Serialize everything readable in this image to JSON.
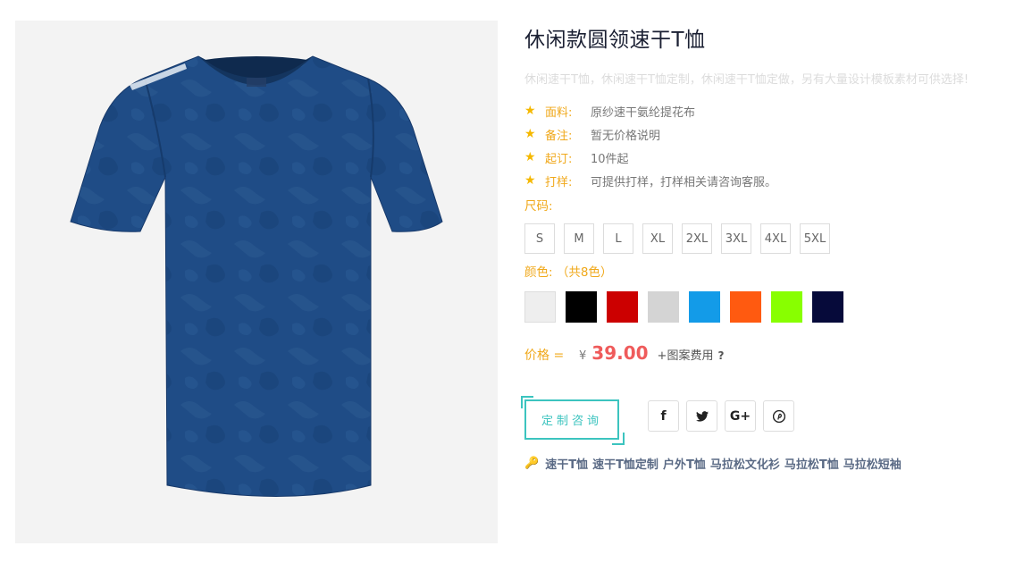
{
  "product": {
    "title": "休闲款圆领速干T恤",
    "description": "休闲速干T恤，休闲速干T恤定制，休闲速干T恤定做，另有大量设计模板素材可供选择!",
    "image_alt": "navy-short-sleeve-tshirt"
  },
  "specs": [
    {
      "icon": "star-icon",
      "key": "面料:",
      "value": "原纱速干氨纶提花布"
    },
    {
      "icon": "star-icon",
      "key": "备注:",
      "value": "暂无价格说明"
    },
    {
      "icon": "star-icon",
      "key": "起订:",
      "value": "10件起"
    },
    {
      "icon": "star-icon",
      "key": "打样:",
      "value": "可提供打样，打样相关请咨询客服。"
    }
  ],
  "sizes": {
    "label": "尺码:",
    "options": [
      "S",
      "M",
      "L",
      "XL",
      "2XL",
      "3XL",
      "4XL",
      "5XL"
    ]
  },
  "colors": {
    "label": "颜色: （共8色）",
    "swatches": [
      "#eeeeee",
      "#000000",
      "#cc0000",
      "#d4d4d4",
      "#139be8",
      "#ff5a10",
      "#88ff00",
      "#060a3a"
    ]
  },
  "price": {
    "label": "价格 =",
    "currency": "¥",
    "amount": "39.00",
    "extra": "+图案费用",
    "help": "?"
  },
  "actions": {
    "consult_label": "定制咨询",
    "social_icons": [
      {
        "name": "facebook-icon",
        "glyph": "f"
      },
      {
        "name": "twitter-icon",
        "glyph": "🐦"
      },
      {
        "name": "google-plus-icon",
        "glyph": "G+"
      },
      {
        "name": "pinterest-icon",
        "glyph": "℗"
      }
    ]
  },
  "tags": {
    "icon": "key-icon",
    "items": [
      "速干T恤",
      "速干T恤定制",
      "户外T恤",
      "马拉松文化衫",
      "马拉松T恤",
      "马拉松短袖"
    ]
  },
  "colors_theme": {
    "accent": "#3cc4bf",
    "label_orange": "#f0a81a",
    "price_red": "#ef5b5b",
    "star": "#f5b800"
  }
}
